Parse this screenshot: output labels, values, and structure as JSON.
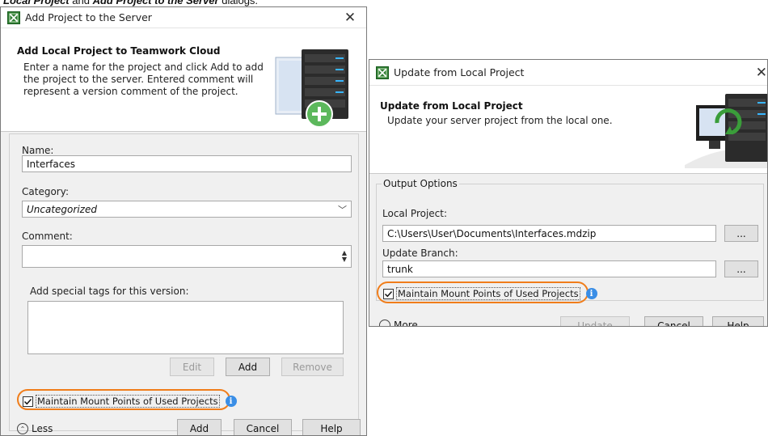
{
  "caption": {
    "bold_part1": "Local Project",
    "plain_and": " and ",
    "bold_part2": "Add Project to the Server",
    "plain_end": " dialogs."
  },
  "dialog_add": {
    "title": "Add Project to the Server",
    "header_title": "Add Local Project to Teamwork Cloud",
    "header_desc": "Enter a name for the project and click Add to add the project to the server. Entered comment will represent a version comment of the project.",
    "name_label": "Name:",
    "name_value": "Interfaces",
    "category_label": "Category:",
    "category_value": "Uncategorized",
    "comment_label": "Comment:",
    "comment_value": "",
    "tags_label": "Add special tags for this version:",
    "edit_button": "Edit",
    "add_tag_button": "Add",
    "remove_button": "Remove",
    "maintain_checkbox_label": "Maintain Mount Points of Used Projects",
    "maintain_checked": true,
    "less_label": "Less",
    "add_button": "Add",
    "cancel_button": "Cancel",
    "help_button": "Help"
  },
  "dialog_update": {
    "title": "Update from Local Project",
    "header_title": "Update from Local Project",
    "header_desc": "Update your server project from the local one.",
    "group_label": "Output Options",
    "local_project_label": "Local Project:",
    "local_project_value": "C:\\Users\\User\\Documents\\Interfaces.mdzip",
    "browse_label": "...",
    "update_branch_label": "Update Branch:",
    "update_branch_value": "trunk",
    "maintain_checkbox_label": "Maintain Mount Points of Used Projects",
    "maintain_checked": true,
    "more_label": "More",
    "update_button": "Update",
    "cancel_button": "Cancel",
    "help_button": "Help"
  },
  "colors": {
    "highlight": "#f07d1a",
    "info": "#3a8ee6",
    "dialog_bg": "#f0f0f0"
  },
  "icons": {
    "app": "magicdraw-app-icon",
    "close": "close-icon",
    "info": "info-icon",
    "server_add": "server-add-illustration",
    "server_sync": "server-sync-illustration"
  }
}
